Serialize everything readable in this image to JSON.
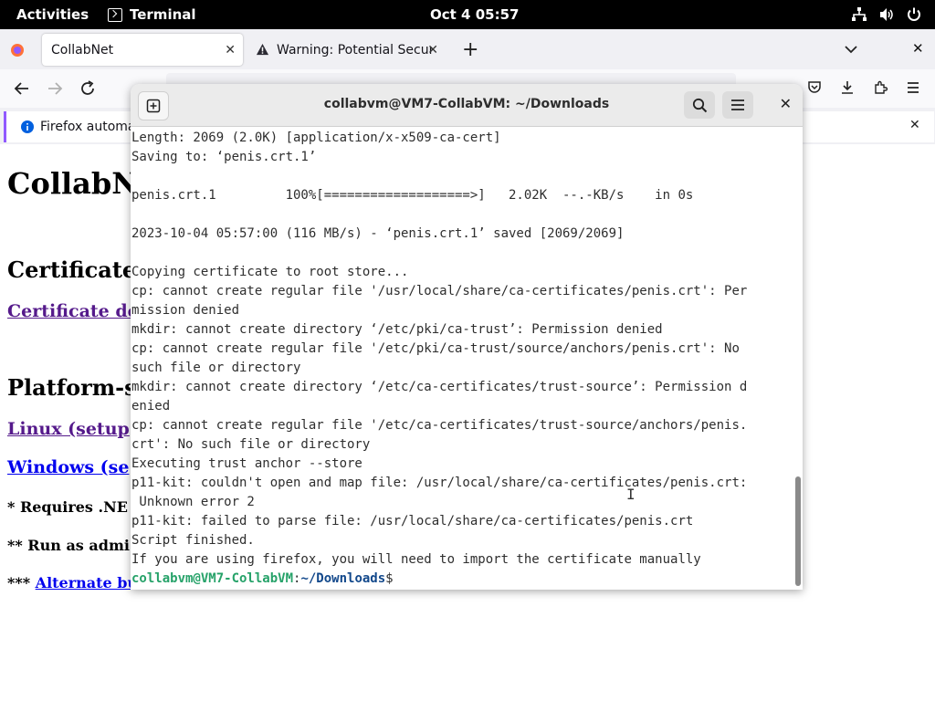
{
  "topbar": {
    "activities": "Activities",
    "app_name": "Terminal",
    "clock": "Oct 4  05:57"
  },
  "browser": {
    "tabs": [
      {
        "label": "CollabNet",
        "active": true
      },
      {
        "label": "Warning: Potential Securi",
        "active": false
      }
    ],
    "notice_text": "Firefox automa"
  },
  "page": {
    "title": "CollabN",
    "cert_heading": "Certificate",
    "cert_link": "Certificate de",
    "platform_heading": "Platform-s",
    "linux_link": "Linux (setup",
    "windows_link": "Windows (se",
    "note1": "* Requires .NE",
    "note2": "** Run as admi",
    "note3_prefix": "*** ",
    "note3_link": "Alternate bu"
  },
  "terminal": {
    "title": "collabvm@VM7-CollabVM: ~/Downloads",
    "lines": [
      "Length: 2069 (2.0K) [application/x-x509-ca-cert]",
      "Saving to: ‘penis.crt.1’",
      "",
      "penis.crt.1         100%[===================>]   2.02K  --.-KB/s    in 0s",
      "",
      "2023-10-04 05:57:00 (116 MB/s) - ‘penis.crt.1’ saved [2069/2069]",
      "",
      "Copying certificate to root store...",
      "cp: cannot create regular file '/usr/local/share/ca-certificates/penis.crt': Per",
      "mission denied",
      "mkdir: cannot create directory ‘/etc/pki/ca-trust’: Permission denied",
      "cp: cannot create regular file '/etc/pki/ca-trust/source/anchors/penis.crt': No",
      "such file or directory",
      "mkdir: cannot create directory ‘/etc/ca-certificates/trust-source’: Permission d",
      "enied",
      "cp: cannot create regular file '/etc/ca-certificates/trust-source/anchors/penis.",
      "crt': No such file or directory",
      "Executing trust anchor --store",
      "p11-kit: couldn't open and map file: /usr/local/share/ca-certificates/penis.crt:",
      " Unknown error 2",
      "p11-kit: failed to parse file: /usr/local/share/ca-certificates/penis.crt",
      "Script finished.",
      "If you are using firefox, you will need to import the certificate manually"
    ],
    "prompt_user": "collabvm@VM7-CollabVM",
    "prompt_sep": ":",
    "prompt_path": "~/Downloads",
    "prompt_symbol": "$"
  }
}
